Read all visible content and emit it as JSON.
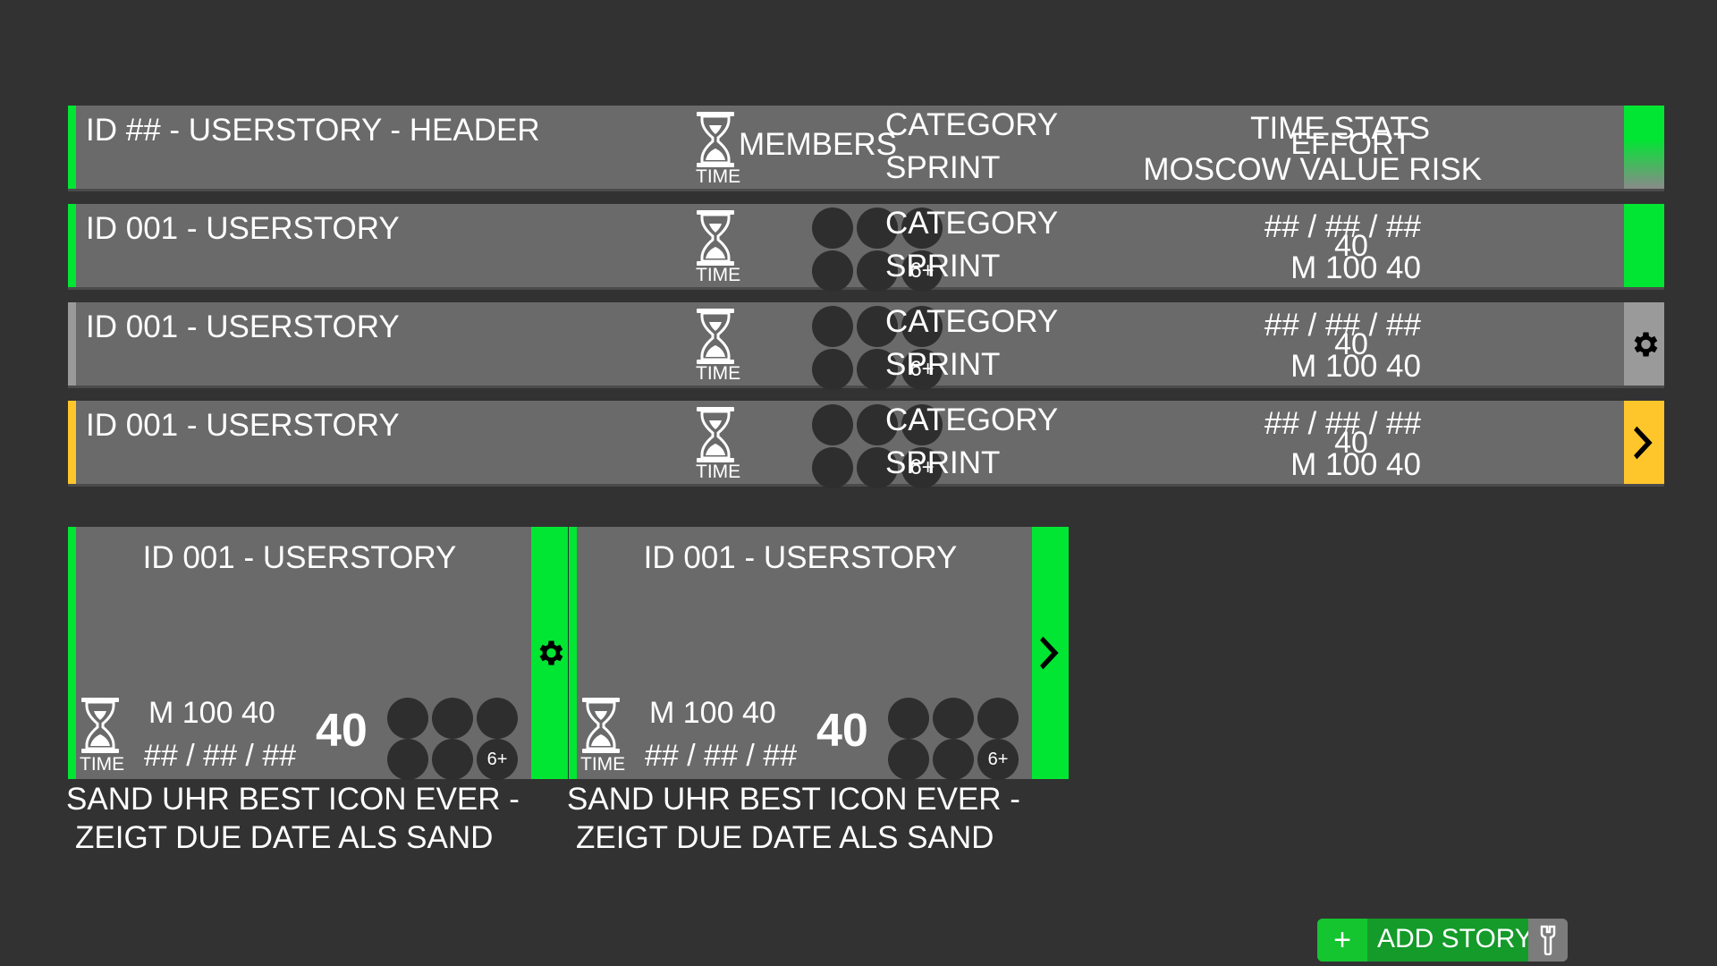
{
  "header_row": {
    "title": "ID ## - USERSTORY - HEADER",
    "time_label": "TIME",
    "members_label": "MEMBERS",
    "category_label": "CATEGORY",
    "sprint_label": "SPRINT",
    "time_stats_label": "TIME STATS",
    "moscow_label": "MOSCOW VALUE RISK",
    "effort_label": "EFFORT",
    "accent": "#00e632"
  },
  "rows": [
    {
      "title": "ID 001 - USERSTORY",
      "time_label": "TIME",
      "more_members": "6+",
      "category": "CATEGORY",
      "sprint": "SPRINT",
      "time_stats": "## / ## / ##",
      "moscow": "M 100 40",
      "effort": "40",
      "accent": "#00e632",
      "action_icon": "none"
    },
    {
      "title": "ID 001 - USERSTORY",
      "time_label": "TIME",
      "more_members": "6+",
      "category": "CATEGORY",
      "sprint": "SPRINT",
      "time_stats": "## / ## / ##",
      "moscow": "M 100 40",
      "effort": "40",
      "accent": "#9a9a9a",
      "action_icon": "gear-icon"
    },
    {
      "title": "ID 001 - USERSTORY",
      "time_label": "TIME",
      "more_members": "6+",
      "category": "CATEGORY",
      "sprint": "SPRINT",
      "time_stats": "## / ## / ##",
      "moscow": "M 100 40",
      "effort": "40",
      "accent": "#ffc62c",
      "action_icon": "chevron-right-icon"
    }
  ],
  "cards": [
    {
      "title": "ID 001 - USERSTORY",
      "time_label": "TIME",
      "moscow": "M 100 40",
      "time_stats": "## / ## / ##",
      "effort": "40",
      "more_members": "6+",
      "action_icon": "gear-icon",
      "caption_line1": "SAND UHR BEST ICON EVER -",
      "caption_line2": "ZEIGT DUE DATE ALS SAND"
    },
    {
      "title": "ID 001 - USERSTORY",
      "time_label": "TIME",
      "moscow": "M 100 40",
      "time_stats": "## / ## / ##",
      "effort": "40",
      "more_members": "6+",
      "action_icon": "chevron-right-icon",
      "caption_line1": "SAND UHR BEST ICON EVER -",
      "caption_line2": "ZEIGT DUE DATE ALS SAND"
    }
  ],
  "add_story": {
    "label": "ADD STORY",
    "plus": "+"
  },
  "colors": {
    "background": "#323232",
    "row": "#6a6a6a",
    "green": "#00e632",
    "yellow": "#ffc62c",
    "grey": "#9a9a9a"
  }
}
